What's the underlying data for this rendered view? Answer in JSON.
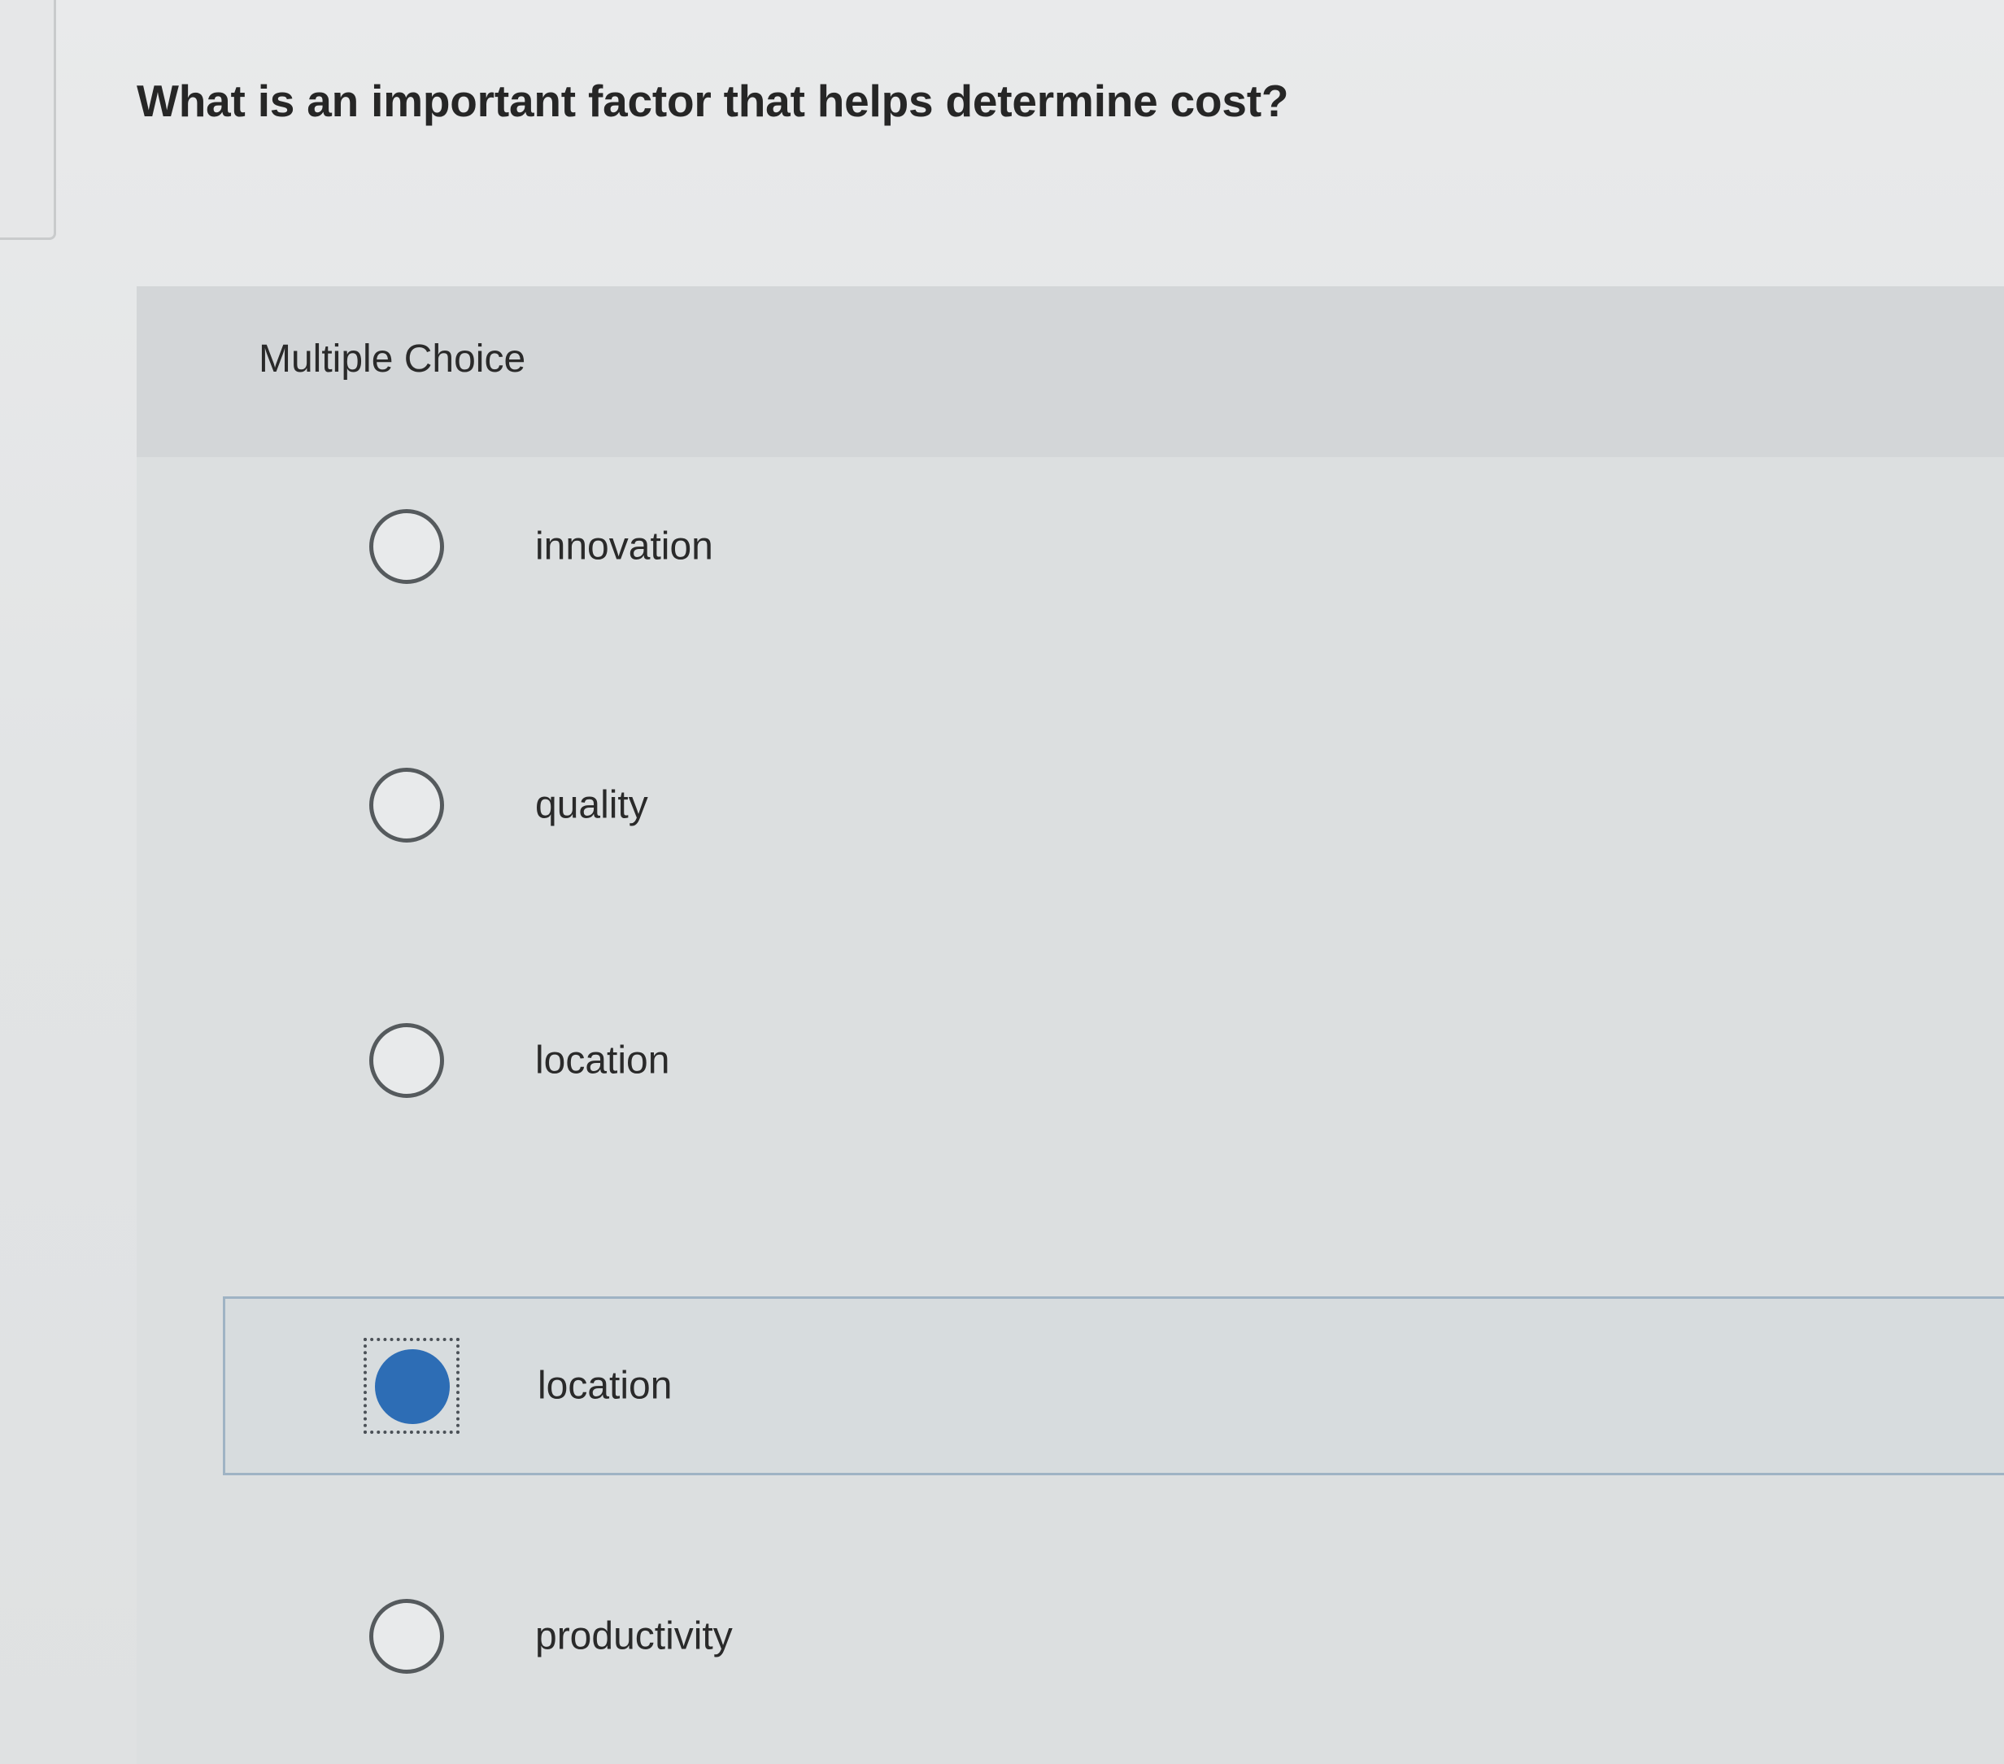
{
  "question": {
    "text": "What is an important factor that helps determine cost?"
  },
  "panel": {
    "type_label": "Multiple Choice"
  },
  "options": [
    {
      "label": "innovation",
      "selected": false
    },
    {
      "label": "quality",
      "selected": false
    },
    {
      "label": "location",
      "selected": false
    },
    {
      "label": "location",
      "selected": true
    },
    {
      "label": "productivity",
      "selected": false
    }
  ],
  "colors": {
    "selected_radio": "#2d6db5",
    "selected_border": "#9fb3c4"
  }
}
